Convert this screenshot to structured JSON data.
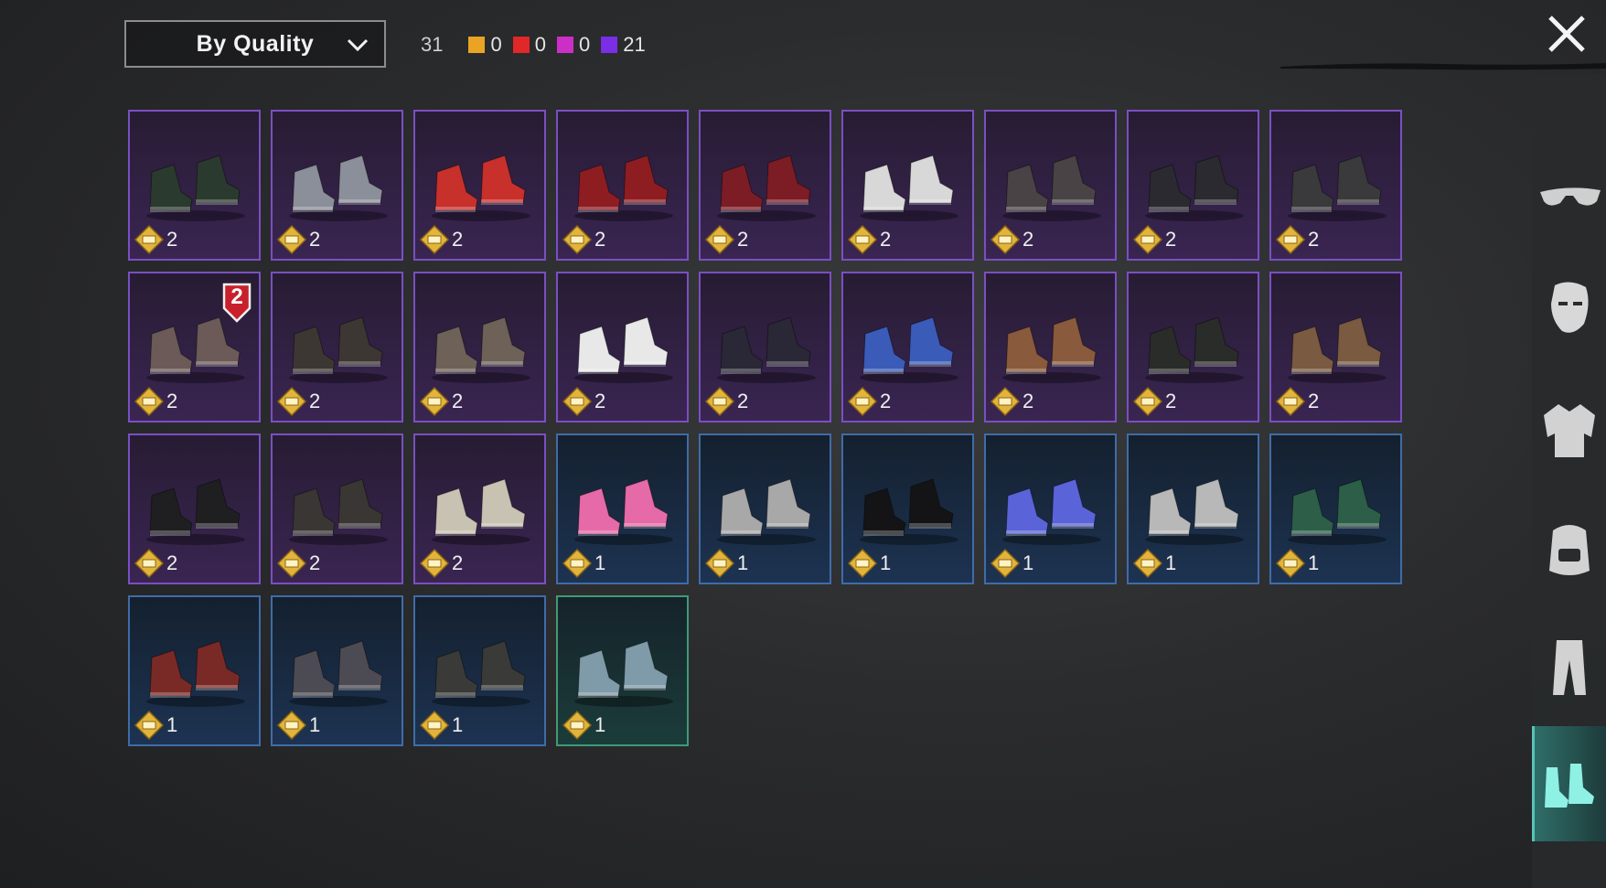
{
  "sort": {
    "label": "By Quality"
  },
  "counts": {
    "total": "31",
    "qualities": [
      {
        "color": "#e8a422",
        "count": "0"
      },
      {
        "color": "#e02828",
        "count": "0"
      },
      {
        "color": "#cc2fc6",
        "count": "0"
      },
      {
        "color": "#7a2ee6",
        "count": "21"
      }
    ]
  },
  "sidebar": {
    "items": [
      {
        "icon": "sunglasses-icon"
      },
      {
        "icon": "face-mask-icon"
      },
      {
        "icon": "jacket-icon"
      },
      {
        "icon": "backpack-icon"
      },
      {
        "icon": "pants-icon"
      },
      {
        "icon": "shoes-icon",
        "active": true
      }
    ]
  },
  "items": [
    {
      "quality": "purple",
      "price": "2",
      "color": "#2b3a2e"
    },
    {
      "quality": "purple",
      "price": "2",
      "color": "#8a8f99"
    },
    {
      "quality": "purple",
      "price": "2",
      "color": "#c8302c"
    },
    {
      "quality": "purple",
      "price": "2",
      "color": "#8e1d22"
    },
    {
      "quality": "purple",
      "price": "2",
      "color": "#7c1c24"
    },
    {
      "quality": "purple",
      "price": "2",
      "color": "#d8d8d8"
    },
    {
      "quality": "purple",
      "price": "2",
      "color": "#4a4346"
    },
    {
      "quality": "purple",
      "price": "2",
      "color": "#2a2a30"
    },
    {
      "quality": "purple",
      "price": "2",
      "color": "#3a3a3c"
    },
    {
      "quality": "purple",
      "price": "2",
      "color": "#6b5a57",
      "badge": "2"
    },
    {
      "quality": "purple",
      "price": "2",
      "color": "#3d3733"
    },
    {
      "quality": "purple",
      "price": "2",
      "color": "#6e6158"
    },
    {
      "quality": "purple",
      "price": "2",
      "color": "#e8e8e8"
    },
    {
      "quality": "purple",
      "price": "2",
      "color": "#2a2836"
    },
    {
      "quality": "purple",
      "price": "2",
      "color": "#3b5bb8"
    },
    {
      "quality": "purple",
      "price": "2",
      "color": "#8a5a3c"
    },
    {
      "quality": "purple",
      "price": "2",
      "color": "#2a2c2a"
    },
    {
      "quality": "purple",
      "price": "2",
      "color": "#7a5a40"
    },
    {
      "quality": "purple",
      "price": "2",
      "color": "#1f1f22"
    },
    {
      "quality": "purple",
      "price": "2",
      "color": "#3a3634"
    },
    {
      "quality": "purple",
      "price": "2",
      "color": "#c8c2b2"
    },
    {
      "quality": "blue",
      "price": "1",
      "color": "#e66aa8"
    },
    {
      "quality": "blue",
      "price": "1",
      "color": "#a8a8a8"
    },
    {
      "quality": "blue",
      "price": "1",
      "color": "#141416"
    },
    {
      "quality": "blue",
      "price": "1",
      "color": "#5a64d8"
    },
    {
      "quality": "blue",
      "price": "1",
      "color": "#b8b8b8"
    },
    {
      "quality": "blue",
      "price": "1",
      "color": "#2c5e48"
    },
    {
      "quality": "blue",
      "price": "1",
      "color": "#7a2a26"
    },
    {
      "quality": "blue",
      "price": "1",
      "color": "#4c4a52"
    },
    {
      "quality": "blue",
      "price": "1",
      "color": "#3a3a38"
    },
    {
      "quality": "green",
      "price": "1",
      "color": "#7f9aa8"
    }
  ]
}
